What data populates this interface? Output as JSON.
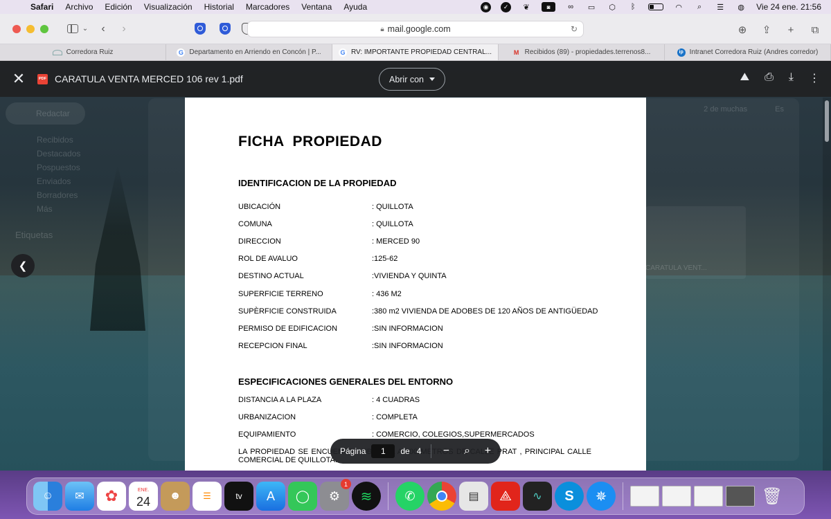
{
  "menubar": {
    "app": "Safari",
    "items": [
      "Archivo",
      "Edición",
      "Visualización",
      "Historial",
      "Marcadores",
      "Ventana",
      "Ayuda"
    ],
    "datetime": "Vie 24 ene.  21:56"
  },
  "browser": {
    "url": "mail.google.com",
    "tabs": [
      {
        "label": "Corredora Ruiz",
        "favicon": "crown-icon",
        "active": false
      },
      {
        "label": "Departamento en Arriendo en Concón | P...",
        "favicon": "google-icon",
        "active": false
      },
      {
        "label": "RV: IMPORTANTE PROPIEDAD CENTRAL...",
        "favicon": "google-icon",
        "active": true
      },
      {
        "label": "Recibidos (89) - propiedades.terrenos8...",
        "favicon": "gmail-icon",
        "active": false
      },
      {
        "label": "Intranet Corredora Ruiz (Andres corredor)",
        "favicon": "ip-icon",
        "active": false
      }
    ]
  },
  "viewer": {
    "file_name": "CARATULA VENTA MERCED 106 rev 1.pdf",
    "pdf_badge": "PDF",
    "open_with": "Abrir con"
  },
  "gmail_background": {
    "compose": "Redactar",
    "folders": [
      "Recibidos",
      "Destacados",
      "Pospuestos",
      "Enviados",
      "Borradores",
      "Más"
    ],
    "labels": "Etiquetas",
    "pagination": "2 de muchas",
    "lang": "Es",
    "attachment": "CARATULA VENT..."
  },
  "document": {
    "title": "FICHA  PROPIEDAD",
    "section1": {
      "heading": "IDENTIFICACION  DE LA PROPIEDAD",
      "rows": [
        {
          "k": "UBICACIÓN",
          "v": ": QUILLOTA"
        },
        {
          "k": "COMUNA",
          "v": ": QUILLOTA"
        },
        {
          "k": "DIRECCION",
          "v": ": MERCED 90"
        },
        {
          "k": "ROL DE AVALUO",
          "v": ":125-62"
        },
        {
          "k": "DESTINO ACTUAL",
          "v": ":VIVIENDA Y QUINTA"
        },
        {
          "k": "SUPERFICIE TERRENO",
          "v": ": 436  M2"
        },
        {
          "k": "SUPÈRFICIE CONSTRUIDA",
          "v": ":380 m2 VIVIENDA DE ADOBES DE 120 AÑOS DE ANTIGÜEDAD"
        },
        {
          "k": "PERMISO DE EDIFICACION",
          "v": ":SIN INFORMACION"
        },
        {
          "k": "RECEPCION FINAL",
          "v": ":SIN INFORMACION"
        }
      ]
    },
    "section2": {
      "heading": "ESPECIFICACIONES GENERALES DEL ENTORNO",
      "rows": [
        {
          "k": "DISTANCIA A LA PLAZA",
          "v": ": 4 CUADRAS"
        },
        {
          "k": "URBANIZACION",
          "v": ": COMPLETA"
        },
        {
          "k": "EQUIPAMIENTO",
          "v": ": COMERCIO, COLEGIOS,SUPERMERCADOS"
        }
      ],
      "paragraph": "LA PROPIEDAD SE ENCUENTRA UBICADA A 100 METROS DE CALLE PRAT , PRINCIPAL CALLE COMERCIAL DE QUILLOTA."
    }
  },
  "pager": {
    "label": "Página",
    "current": "1",
    "of": "de",
    "total": "4"
  },
  "dock": {
    "calendar_month": "ENE.",
    "calendar_day": "24",
    "settings_badge": "1",
    "tv_label": "tv"
  }
}
